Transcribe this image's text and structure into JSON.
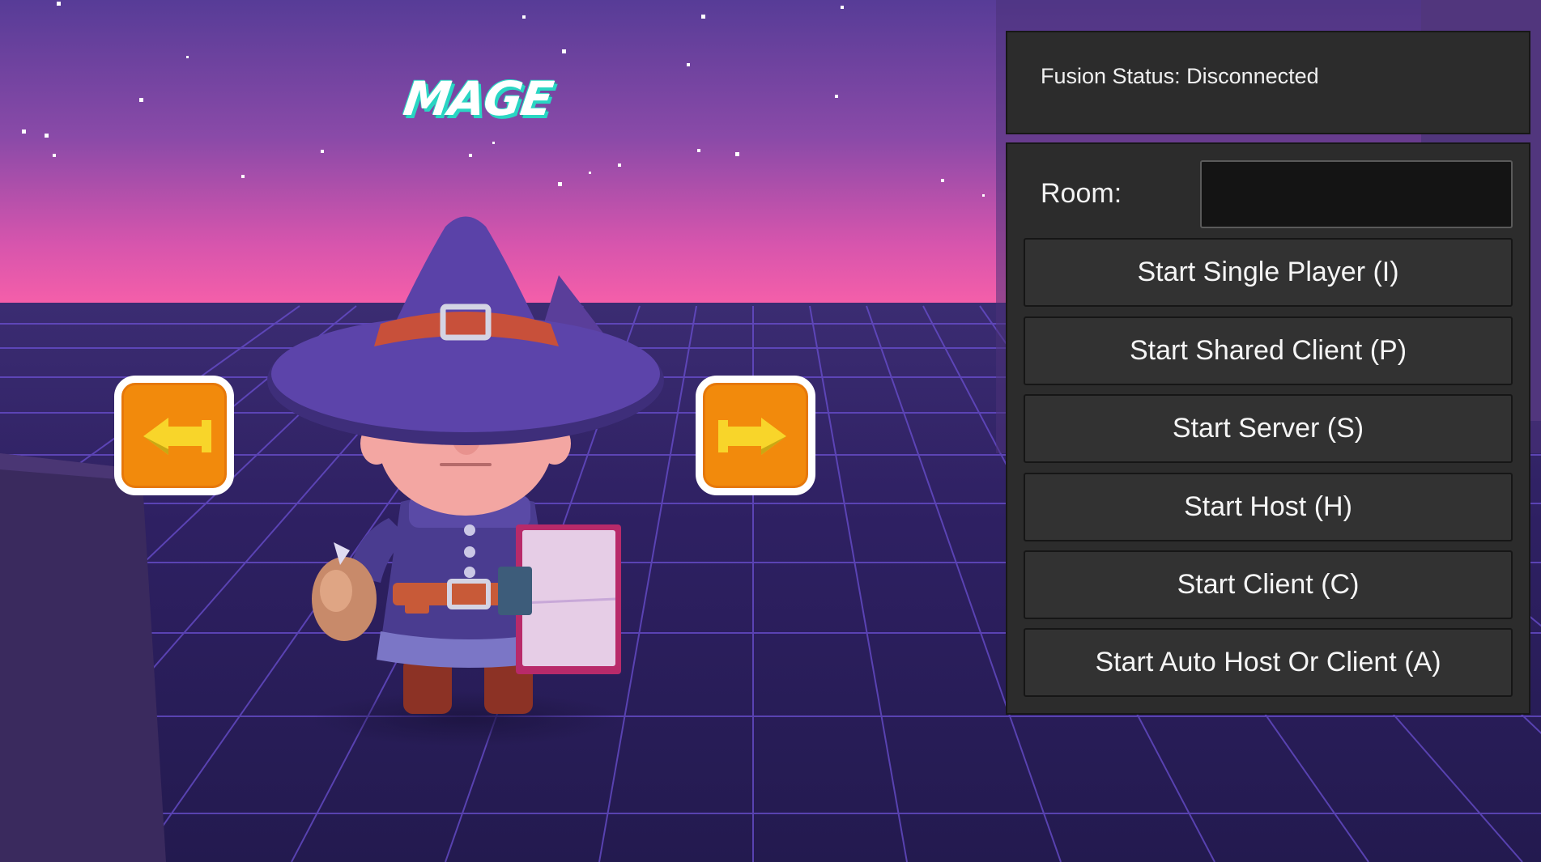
{
  "character": {
    "name": "MAGE",
    "prev_icon": "arrow-left-icon",
    "next_icon": "arrow-right-icon"
  },
  "status": {
    "text": "Fusion Status: Disconnected"
  },
  "room": {
    "label": "Room:",
    "value": ""
  },
  "buttons": {
    "single_player": "Start Single Player (I)",
    "shared_client": "Start Shared Client (P)",
    "server": "Start Server (S)",
    "host": "Start Host (H)",
    "client": "Start Client (C)",
    "auto": "Start Auto Host Or Client (A)"
  },
  "colors": {
    "sky_top": "#5a3d9a",
    "horizon": "#f25aa8",
    "floor": "#2a1d5c",
    "grid": "#6a4fd0",
    "arrow_button": "#f28a0c",
    "arrow": "#f8d52a",
    "panel": "#2c2c2c",
    "title_accent": "#29d6c3"
  }
}
